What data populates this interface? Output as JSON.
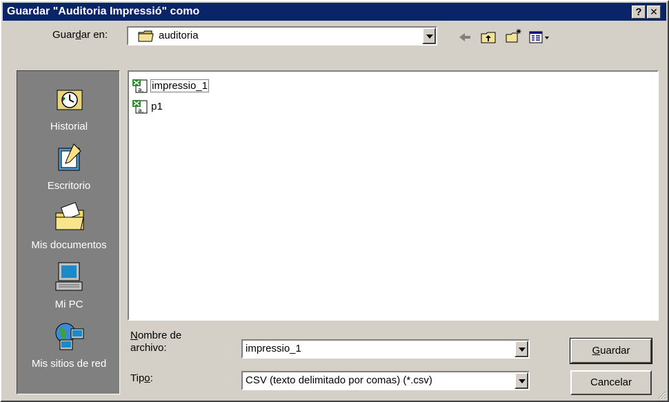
{
  "window": {
    "title": "Guardar \"Auditoria Impressió\" como",
    "help_label": "?",
    "close_label": "✕"
  },
  "lookin": {
    "label_pre": "Guar",
    "label_u": "d",
    "label_post": "ar en:",
    "value": "auditoria"
  },
  "places": [
    {
      "label": "Historial",
      "icon": "history-icon"
    },
    {
      "label": "Escritorio",
      "icon": "desktop-icon"
    },
    {
      "label": "Mis documentos",
      "icon": "my-documents-icon"
    },
    {
      "label": "Mi PC",
      "icon": "my-computer-icon"
    },
    {
      "label": "Mis sitios de red",
      "icon": "network-places-icon"
    }
  ],
  "files": [
    {
      "name": "impressio_1",
      "icon": "csv-file-icon",
      "selected": true
    },
    {
      "name": "p1",
      "icon": "csv-file-icon",
      "selected": false
    }
  ],
  "filename": {
    "label_u": "N",
    "label_line1": "ombre de",
    "label_line2": "archivo:",
    "value": "impressio_1"
  },
  "filetype": {
    "label_pre": "Tip",
    "label_u": "o",
    "label_post": ":",
    "value": "CSV (texto delimitado por comas) (*.csv)"
  },
  "buttons": {
    "save_u": "G",
    "save_rest": "uardar",
    "cancel": "Cancelar"
  }
}
